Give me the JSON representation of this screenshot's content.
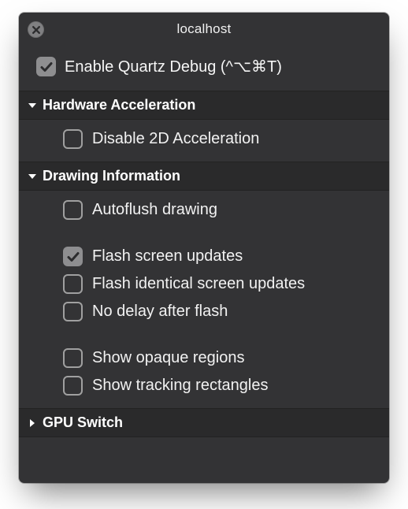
{
  "window": {
    "title": "localhost"
  },
  "main": {
    "enable_label": "Enable Quartz Debug (^⌥⌘T)",
    "enable_checked": true
  },
  "sections": {
    "hardware": {
      "title": "Hardware Acceleration",
      "expanded": true,
      "items": {
        "disable_2d": {
          "label": "Disable 2D Acceleration",
          "checked": false
        }
      }
    },
    "drawing": {
      "title": "Drawing Information",
      "expanded": true,
      "items": {
        "autoflush": {
          "label": "Autoflush drawing",
          "checked": false
        },
        "flash_updates": {
          "label": "Flash screen updates",
          "checked": true
        },
        "flash_identical": {
          "label": "Flash identical screen updates",
          "checked": false
        },
        "no_delay": {
          "label": "No delay after flash",
          "checked": false
        },
        "opaque": {
          "label": "Show opaque regions",
          "checked": false
        },
        "tracking": {
          "label": "Show tracking rectangles",
          "checked": false
        }
      }
    },
    "gpu": {
      "title": "GPU Switch",
      "expanded": false
    }
  }
}
